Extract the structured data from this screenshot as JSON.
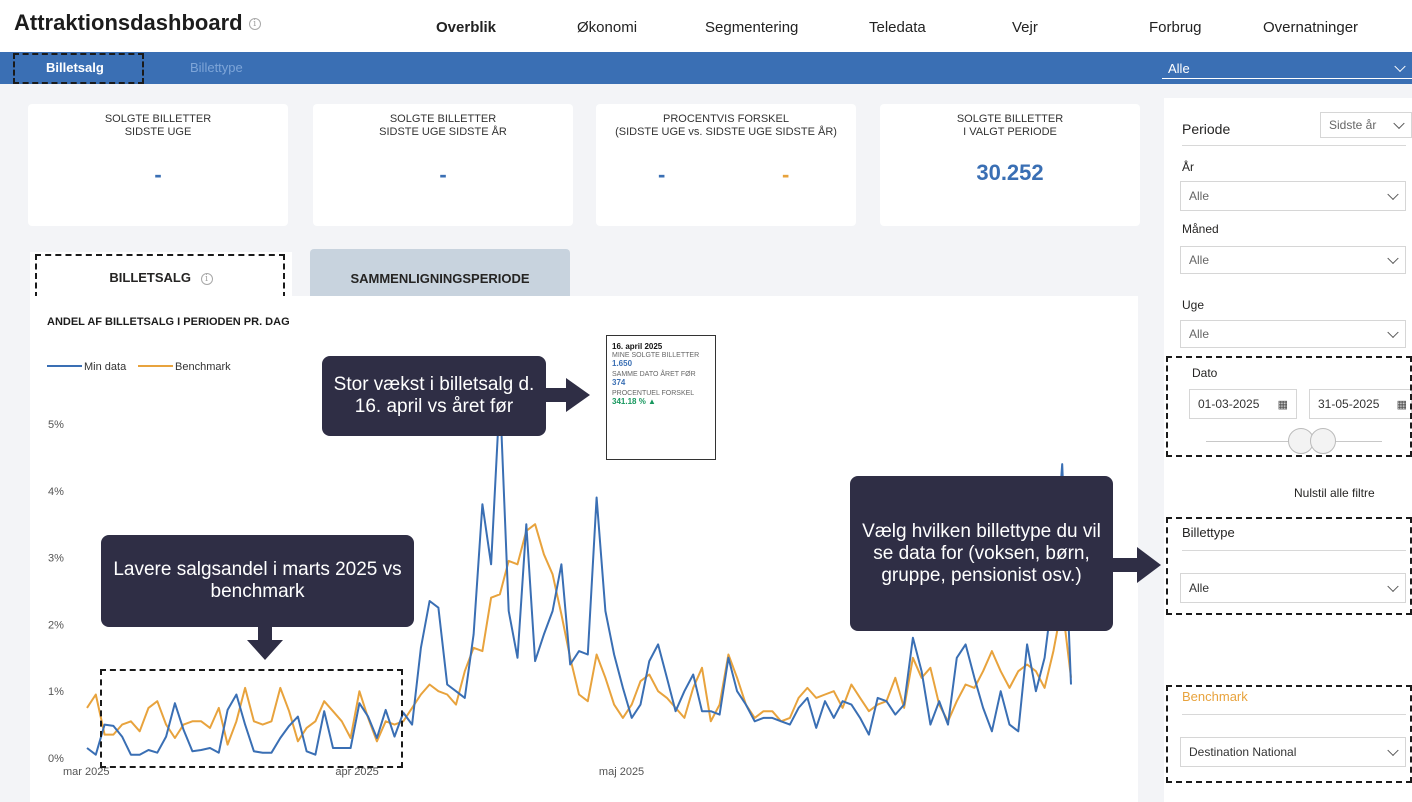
{
  "header": {
    "title": "Attraktionsdashboard",
    "tabs": [
      "Overblik",
      "Økonomi",
      "Segmentering",
      "Teledata",
      "Vejr",
      "Forbrug",
      "Overnatninger"
    ],
    "active_tab": "Overblik"
  },
  "subnav": {
    "tabs": [
      "Billetsalg",
      "Billettype"
    ],
    "active": "Billetsalg",
    "select_value": "Alle"
  },
  "kpis": [
    {
      "title": "SOLGTE BILLETTER\nSIDSTE UGE",
      "value": "-"
    },
    {
      "title": "SOLGTE BILLETTER\nSIDSTE UGE SIDSTE ÅR",
      "value": "-"
    },
    {
      "title": "PROCENTVIS FORSKEL\n(SIDSTE UGE vs. SIDSTE UGE SIDSTE ÅR)",
      "value_a": "-",
      "value_b": "-"
    },
    {
      "title": "SOLGTE BILLETTER\nI VALGT PERIODE",
      "value": "30.252"
    }
  ],
  "chart_tabs": {
    "active": "BILLETSALG",
    "inactive": "SAMMENLIGNINGSPERIODE"
  },
  "chart_data": {
    "type": "line",
    "title": "ANDEL AF BILLETSALG I PERIODEN PR. DAG",
    "x_ticks": [
      "mar 2025",
      "apr 2025",
      "maj 2025"
    ],
    "y_ticks": [
      "0%",
      "1%",
      "2%",
      "3%",
      "4%",
      "5%"
    ],
    "ylim": [
      0,
      5.6
    ],
    "legend_position": "top-left",
    "series": [
      {
        "name": "Min data",
        "color": "#3a6fb4",
        "values": [
          0.15,
          0.05,
          0.5,
          0.48,
          0.32,
          0.05,
          0.05,
          0.12,
          0.08,
          0.32,
          0.82,
          0.42,
          0.1,
          0.12,
          0.15,
          0.08,
          0.72,
          0.95,
          0.5,
          0.1,
          0.08,
          0.08,
          0.3,
          0.48,
          0.62,
          0.1,
          0.05,
          0.7,
          0.15,
          0.15,
          0.15,
          0.82,
          0.62,
          0.3,
          0.72,
          0.32,
          0.68,
          0.5,
          1.65,
          2.35,
          2.25,
          1.1,
          1.0,
          0.9,
          1.85,
          3.8,
          2.9,
          5.45,
          2.2,
          1.5,
          3.5,
          1.45,
          1.85,
          2.2,
          2.9,
          1.4,
          1.6,
          1.55,
          3.9,
          2.2,
          1.55,
          1.05,
          0.6,
          0.8,
          1.45,
          1.7,
          1.2,
          0.7,
          1.0,
          1.25,
          0.7,
          0.7,
          0.65,
          1.5,
          1.0,
          0.8,
          0.55,
          0.6,
          0.6,
          0.55,
          0.5,
          0.75,
          0.9,
          0.45,
          0.85,
          0.6,
          0.85,
          0.8,
          0.6,
          0.35,
          0.9,
          0.85,
          0.65,
          0.8,
          1.8,
          1.3,
          0.5,
          0.85,
          0.5,
          1.5,
          1.7,
          1.2,
          0.75,
          0.4,
          1.0,
          0.5,
          0.4,
          1.7,
          1.0,
          1.5,
          2.55,
          4.4,
          1.1
        ]
      },
      {
        "name": "Benchmark",
        "color": "#e8a33d",
        "values": [
          0.75,
          0.95,
          0.35,
          0.35,
          0.5,
          0.55,
          0.4,
          0.75,
          0.85,
          0.5,
          0.3,
          0.5,
          0.55,
          0.55,
          0.45,
          0.75,
          0.2,
          0.55,
          1.05,
          0.55,
          0.5,
          0.55,
          1.05,
          0.7,
          0.25,
          0.45,
          0.55,
          0.85,
          0.7,
          0.55,
          0.3,
          1.0,
          0.6,
          0.25,
          0.55,
          0.5,
          0.55,
          0.75,
          0.95,
          1.1,
          1.0,
          0.95,
          0.8,
          1.3,
          1.65,
          1.6,
          2.4,
          2.45,
          2.95,
          2.9,
          3.4,
          3.5,
          3.05,
          2.75,
          2.15,
          1.5,
          0.95,
          0.85,
          1.55,
          1.2,
          0.8,
          0.6,
          0.8,
          1.15,
          1.25,
          1.0,
          0.9,
          0.75,
          0.6,
          1.05,
          1.35,
          0.55,
          0.8,
          1.55,
          1.2,
          0.8,
          0.6,
          0.7,
          0.7,
          0.55,
          0.6,
          0.9,
          1.05,
          0.9,
          0.95,
          1.0,
          0.75,
          1.1,
          0.9,
          0.7,
          0.8,
          0.85,
          1.2,
          0.75,
          1.5,
          1.2,
          1.35,
          0.8,
          0.55,
          0.85,
          1.1,
          1.05,
          1.3,
          1.6,
          1.3,
          1.05,
          1.3,
          1.4,
          1.3,
          1.05,
          1.6,
          2.3,
          1.2
        ]
      }
    ]
  },
  "tooltip": {
    "date": "16. april 2025",
    "label1": "MINE SOLGTE BILLETTER",
    "value1": "1.650",
    "label2": "SAMME DATO ÅRET FØR",
    "value2": "374",
    "label3": "PROCENTUEL FORSKEL",
    "value3": "341.18 % ▲"
  },
  "callouts": {
    "growth": "Stor vækst i billetsalg d. 16. april vs året før",
    "march": "Lavere salgsandel i marts 2025 vs benchmark",
    "ticket_type": "Vælg hvilken billettype du vil se data for (voksen, børn, gruppe, pensionist osv.)"
  },
  "filters": {
    "periode_label": "Periode",
    "periode_value": "Sidste år",
    "aar_label": "År",
    "aar_value": "Alle",
    "maaned_label": "Måned",
    "maaned_value": "Alle",
    "uge_label": "Uge",
    "uge_value": "Alle",
    "dato_label": "Dato",
    "dato_from": "01-03-2025",
    "dato_to": "31-05-2025",
    "reset_label": "Nulstil alle filtre",
    "billettype_label": "Billettype",
    "billettype_value": "Alle",
    "benchmark_label": "Benchmark",
    "benchmark_value": "Destination National"
  },
  "colors": {
    "accent": "#3a6fb4",
    "benchmark": "#e8a33d",
    "callout": "#2f2e45",
    "positive": "#17975e"
  }
}
